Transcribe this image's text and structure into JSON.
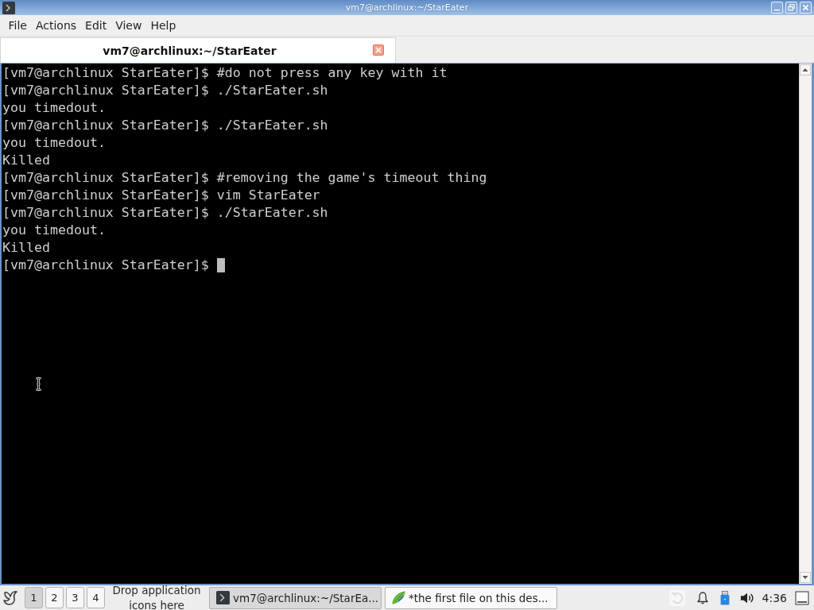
{
  "window": {
    "title": "vm7@archlinux:~/StarEater"
  },
  "menu": [
    "File",
    "Actions",
    "Edit",
    "View",
    "Help"
  ],
  "tabs": [
    {
      "label": "vm7@archlinux:~/StarEater",
      "selected": true
    }
  ],
  "terminal": {
    "lines": [
      "[vm7@archlinux StarEater]$ #do not press any key with it",
      "[vm7@archlinux StarEater]$ ./StarEater.sh",
      "you timedout.",
      "[vm7@archlinux StarEater]$ ./StarEater.sh",
      "you timedout.",
      "Killed",
      "[vm7@archlinux StarEater]$ #removing the game's timeout thing",
      "[vm7@archlinux StarEater]$ vim StarEater",
      "[vm7@archlinux StarEater]$ ./StarEater.sh",
      "you timedout.",
      "Killed",
      "[vm7@archlinux StarEater]$"
    ],
    "cursor": true
  },
  "taskbar": {
    "desktops": [
      {
        "label": "1",
        "selected": true
      },
      {
        "label": "2",
        "selected": false
      },
      {
        "label": "3",
        "selected": false
      },
      {
        "label": "4",
        "selected": false
      }
    ],
    "quicklaunch_hint": "Drop application icons here",
    "tasks": [
      {
        "kind": "terminal",
        "label": "vm7@archlinux:~/StarEa...",
        "selected": true
      },
      {
        "kind": "editor",
        "label": "*the first file on this des...",
        "selected": false
      }
    ],
    "clock": "4:36"
  }
}
